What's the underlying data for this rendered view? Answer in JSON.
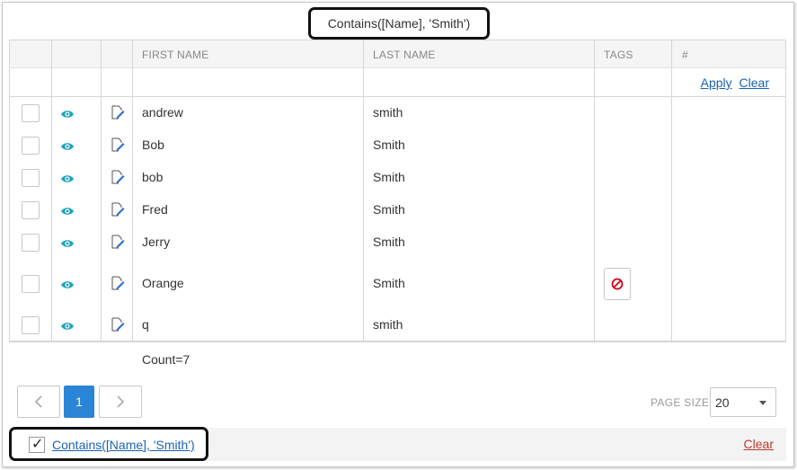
{
  "filter_caption": "Contains([Name], 'Smith')",
  "columns": {
    "first_name": "FIRST NAME",
    "last_name": "LAST NAME",
    "tags": "TAGS",
    "hash": "#"
  },
  "filter_row": {
    "apply_label": "Apply",
    "clear_label": "Clear"
  },
  "rows": [
    {
      "first": "andrew",
      "last": "smith",
      "has_tag": false
    },
    {
      "first": "Bob",
      "last": "Smith",
      "has_tag": false
    },
    {
      "first": "bob",
      "last": "Smith",
      "has_tag": false
    },
    {
      "first": "Fred",
      "last": "Smith",
      "has_tag": false
    },
    {
      "first": "Jerry",
      "last": "Smith",
      "has_tag": false
    },
    {
      "first": "Orange",
      "last": "Smith",
      "has_tag": true
    },
    {
      "first": "q",
      "last": "smith",
      "has_tag": false
    }
  ],
  "footer": {
    "count": "Count=7"
  },
  "pager": {
    "current_page": "1",
    "page_size_label": "PAGE SIZE",
    "page_size_value": "20"
  },
  "bottom_bar": {
    "filter_text": "Contains([Name], 'Smith')",
    "filter_checked": true,
    "clear_label": "Clear"
  },
  "colors": {
    "accent": "#2b85d6",
    "link": "#1a63b6",
    "eye_icon": "#1aa3b8",
    "clear_red": "#c0392b",
    "tag_icon": "#d0021b"
  }
}
